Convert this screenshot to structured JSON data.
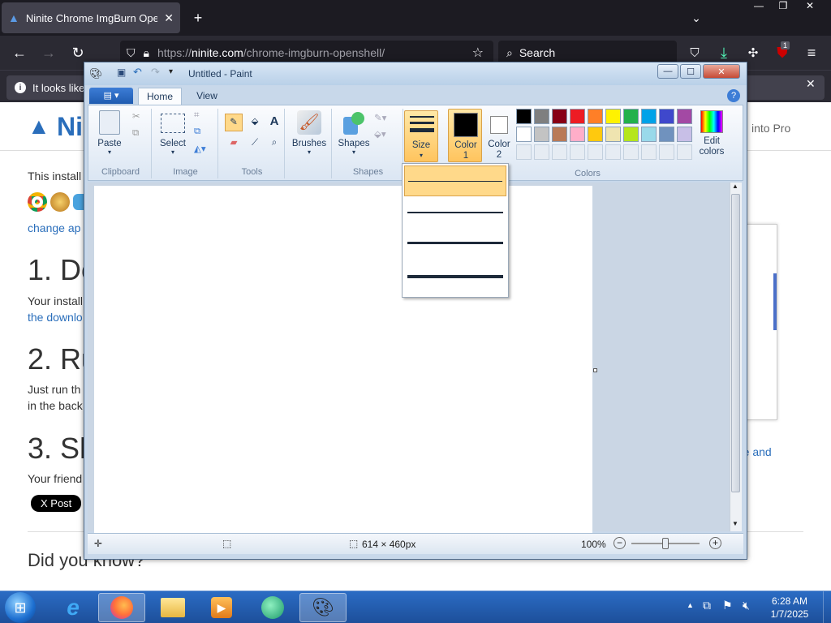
{
  "browser": {
    "tab_title": "Ninite Chrome ImgBurn Open",
    "url_prefix": "https://",
    "url_domain": "ninite.com",
    "url_path": "/chrome-imgburn-openshell/",
    "search_placeholder": "Search",
    "notification_text": "It looks like",
    "extension_badge": "1"
  },
  "page": {
    "logo_text": "Ni",
    "nav_right": "into Pro",
    "intro": "This install",
    "change_apps": "change ap",
    "step1": "1. Do",
    "step1_text1": "Your install",
    "step1_text2": "the downlo",
    "step2": "2. Ru",
    "step2_text1": "Just run th",
    "step2_text2": "in the back",
    "step3": "3. Sh",
    "step3_text": "Your friend",
    "step3_right": "re and",
    "x_post": "X Post",
    "did_you_know": "Did you know?"
  },
  "paint": {
    "title": "Untitled - Paint",
    "tabs": [
      "Home",
      "View"
    ],
    "groups": {
      "clipboard": "Clipboard",
      "image": "Image",
      "tools": "Tools",
      "shapes": "Shapes",
      "colors": "Colors"
    },
    "buttons": {
      "paste": "Paste",
      "select": "Select",
      "brushes": "Brushes",
      "shapes": "Shapes",
      "size": "Size",
      "color1": "Color 1",
      "color2": "Color 2",
      "edit_colors": "Edit colors"
    },
    "status": {
      "dimensions": "614 × 460px",
      "zoom": "100%"
    },
    "palette_row1": [
      "#000000",
      "#7f7f7f",
      "#880015",
      "#ed1c24",
      "#ff7f27",
      "#fff200",
      "#22b14c",
      "#00a2e8",
      "#3f48cc",
      "#a349a4"
    ],
    "palette_row2": [
      "#ffffff",
      "#c3c3c3",
      "#b97a57",
      "#ffaec9",
      "#ffc90e",
      "#efe4b0",
      "#b5e61d",
      "#99d9ea",
      "#7092be",
      "#c8bfe7"
    ],
    "size_options": [
      "1px",
      "3px",
      "5px",
      "8px"
    ]
  },
  "taskbar": {
    "time": "6:28 AM",
    "date": "1/7/2025"
  }
}
